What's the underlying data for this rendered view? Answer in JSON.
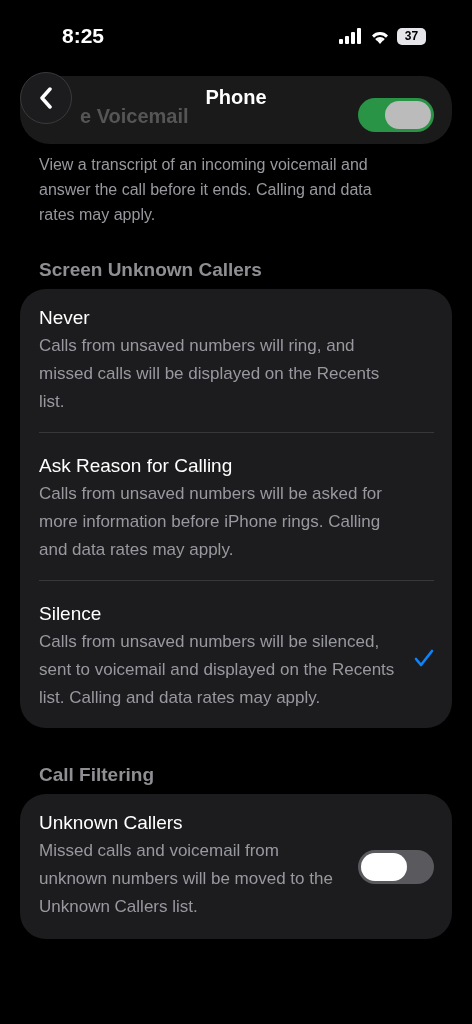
{
  "status_bar": {
    "time": "8:25",
    "battery": "37"
  },
  "nav": {
    "title": "Phone"
  },
  "behind_header": {
    "label": "e Voicemail",
    "on": true
  },
  "voicemail_footer": "View a transcript of an incoming voicemail and answer the call before it ends. Calling and data rates may apply.",
  "screen_section": {
    "header": "Screen Unknown Callers",
    "options": [
      {
        "title": "Never",
        "description": "Calls from unsaved numbers will ring, and missed calls will be displayed on the Recents list.",
        "selected": false
      },
      {
        "title": "Ask Reason for Calling",
        "description": "Calls from unsaved numbers will be asked for more information before iPhone rings. Calling and data rates may apply.",
        "selected": false
      },
      {
        "title": "Silence",
        "description": "Calls from unsaved numbers will be silenced, sent to voicemail and displayed on the Recents list. Calling and data rates may apply.",
        "selected": true
      }
    ]
  },
  "filter_section": {
    "header": "Call Filtering",
    "title": "Unknown Callers",
    "description": "Missed calls and voicemail from unknown numbers will be moved to the Unknown Callers list.",
    "on": false
  }
}
